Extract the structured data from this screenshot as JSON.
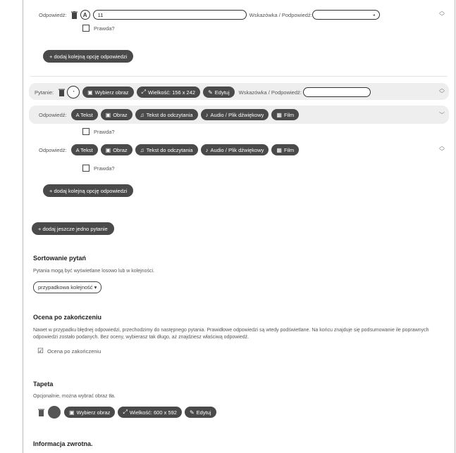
{
  "answer_label": "Odpowiedź:",
  "question_label": "Pytanie:",
  "hint_label": "Wskazówka / Podpowiedź:",
  "true_label": "Prawda?",
  "top_answer": {
    "type_letter": "A",
    "value": "11"
  },
  "add_option_label": "+ dodaj kolejną opcję odpowiedzi",
  "question_buttons": {
    "choose_image": "Wybierz obraz",
    "size": "Wielkość: 156 x 242",
    "edit": "Edytuj"
  },
  "media_buttons": {
    "text": "A Tekst",
    "image": "Obraz",
    "tts": "Tekst do odczytania",
    "audio": "Audio / Plik dźwiękowy",
    "film": "Film"
  },
  "add_question_label": "+ dodaj jeszcze jedno pytanie",
  "sort": {
    "heading": "Sortowanie pytań",
    "desc": "Pytania mogą być wyświetlane losowo lub w kolejności.",
    "select": "przypadkowa kolejność ▾"
  },
  "grade": {
    "heading": "Ocena po zakończeniu",
    "desc": "Nawet w przypadku błędnej odpowiedzi, przechodzimy do następnego pytania. Prawidłowe odpowiedzi są wtedy podświetlane. Na końcu znajduje się podsumowanie ile poprawnych odpowiedzi zostało podanych. Bez oceny, wybierasz tak długo, aż znajdziesz właściwą odpowiedź.",
    "checkbox": "Ocena po zakończeniu"
  },
  "wallpaper": {
    "heading": "Tapeta",
    "desc": "Opcjonalnie, można wybrać obraz tła.",
    "choose_image": "Wybierz obraz",
    "size": "Wielkość: 600 x 592",
    "edit": "Edytuj"
  },
  "feedback_heading": "Informacja zwrotna."
}
